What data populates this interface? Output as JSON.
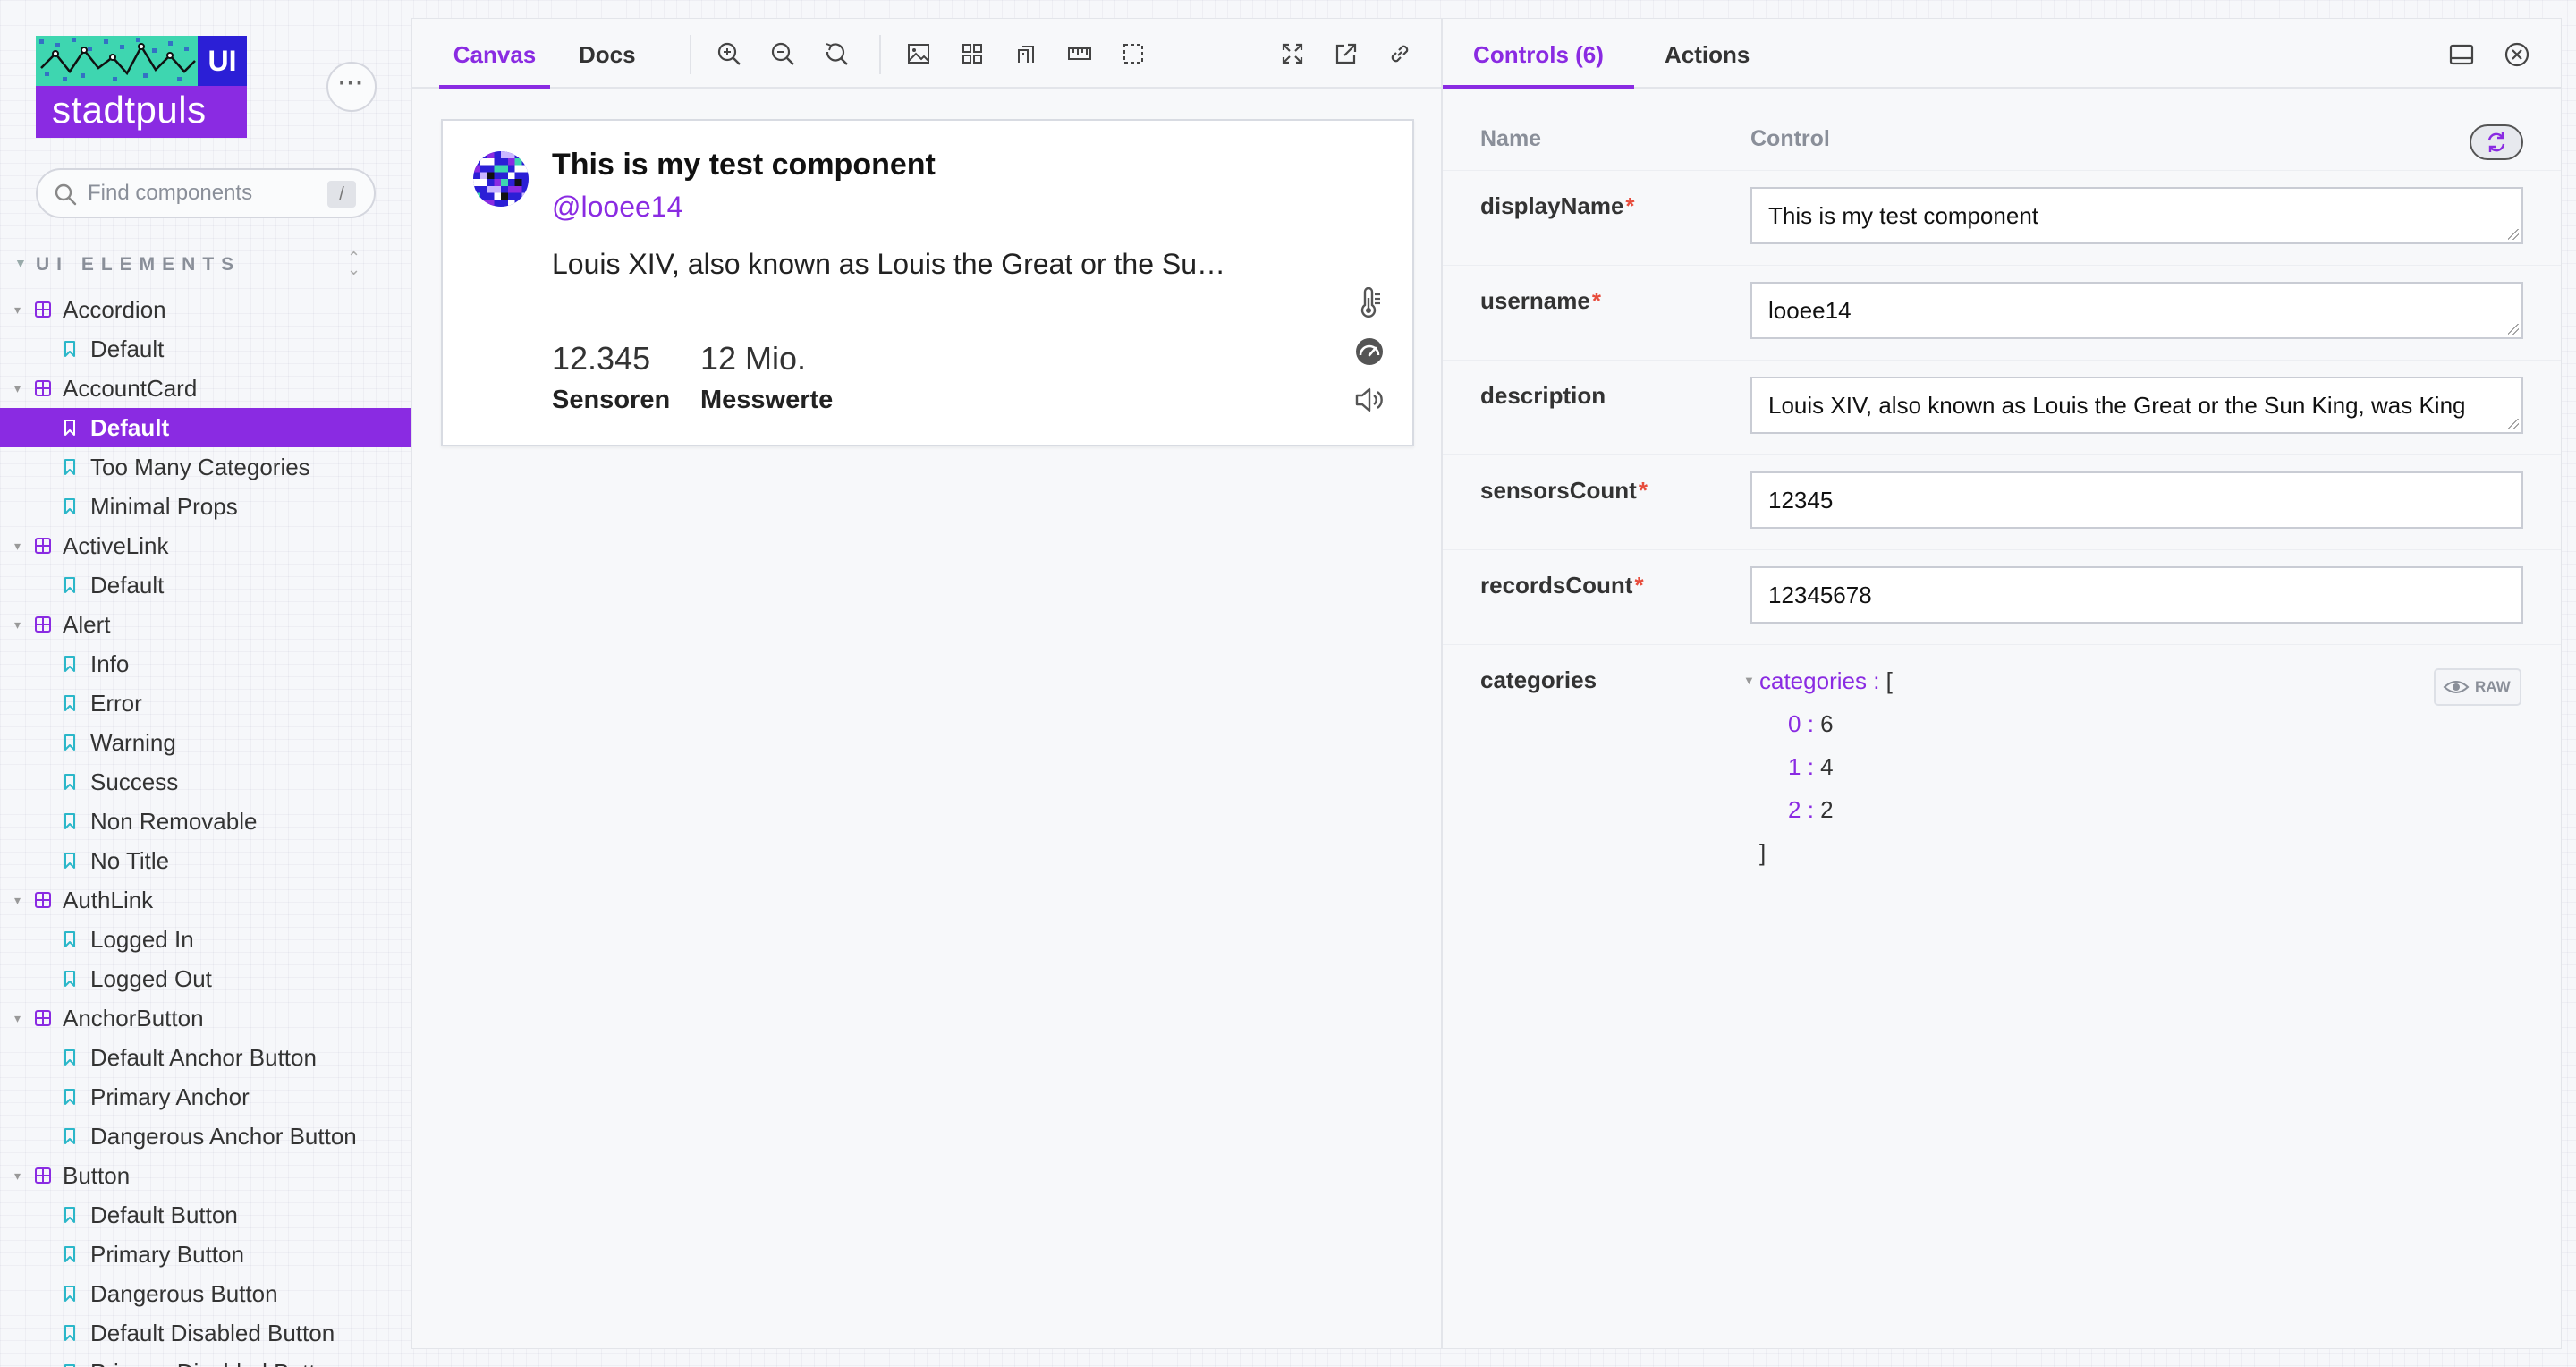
{
  "brand": {
    "logo_badge": "UI",
    "logo_name": "stadtpuls"
  },
  "sidebar": {
    "search_placeholder": "Find components",
    "search_shortcut": "/",
    "section_label": "UI ELEMENTS",
    "items": [
      {
        "type": "component",
        "label": "Accordion"
      },
      {
        "type": "story",
        "label": "Default"
      },
      {
        "type": "component",
        "label": "AccountCard"
      },
      {
        "type": "story",
        "label": "Default",
        "selected": true
      },
      {
        "type": "story",
        "label": "Too Many Categories"
      },
      {
        "type": "story",
        "label": "Minimal Props"
      },
      {
        "type": "component",
        "label": "ActiveLink"
      },
      {
        "type": "story",
        "label": "Default"
      },
      {
        "type": "component",
        "label": "Alert"
      },
      {
        "type": "story",
        "label": "Info"
      },
      {
        "type": "story",
        "label": "Error"
      },
      {
        "type": "story",
        "label": "Warning"
      },
      {
        "type": "story",
        "label": "Success"
      },
      {
        "type": "story",
        "label": "Non Removable"
      },
      {
        "type": "story",
        "label": "No Title"
      },
      {
        "type": "component",
        "label": "AuthLink"
      },
      {
        "type": "story",
        "label": "Logged In"
      },
      {
        "type": "story",
        "label": "Logged Out"
      },
      {
        "type": "component",
        "label": "AnchorButton"
      },
      {
        "type": "story",
        "label": "Default Anchor Button"
      },
      {
        "type": "story",
        "label": "Primary Anchor"
      },
      {
        "type": "story",
        "label": "Dangerous Anchor Button"
      },
      {
        "type": "component",
        "label": "Button"
      },
      {
        "type": "story",
        "label": "Default Button"
      },
      {
        "type": "story",
        "label": "Primary Button"
      },
      {
        "type": "story",
        "label": "Dangerous Button"
      },
      {
        "type": "story",
        "label": "Default Disabled Button"
      },
      {
        "type": "story",
        "label": "Primary Disabled Button"
      }
    ]
  },
  "canvas": {
    "tabs": [
      "Canvas",
      "Docs"
    ],
    "active_tab": "Canvas",
    "toolbar_icons": [
      "zoom-in-icon",
      "zoom-out-icon",
      "zoom-reset-icon",
      "image-icon",
      "grid-icon",
      "background-icon",
      "ruler-icon",
      "outline-icon",
      "fullscreen-icon",
      "open-new-tab-icon",
      "link-icon"
    ]
  },
  "preview": {
    "display_name": "This is my test component",
    "username": "@looee14",
    "description": "Louis XIV, also known as Louis the Great or the Su…",
    "stats": [
      {
        "value": "12.345",
        "label": "Sensoren"
      },
      {
        "value": "12 Mio.",
        "label": "Messwerte"
      }
    ],
    "category_icons": [
      "thermometer-icon",
      "gauge-icon",
      "speaker-icon"
    ]
  },
  "controls": {
    "tabs": [
      "Controls (6)",
      "Actions"
    ],
    "active_tab": "Controls (6)",
    "header_name": "Name",
    "header_control": "Control",
    "rows": {
      "displayName": {
        "name": "displayName",
        "required": "*",
        "value": "This is my test component"
      },
      "username": {
        "name": "username",
        "required": "*",
        "value": "looee14"
      },
      "description": {
        "name": "description",
        "required": "",
        "value": "Louis XIV, also known as Louis the Great or the Sun King, was King"
      },
      "sensorsCount": {
        "name": "sensorsCount",
        "required": "*",
        "value": "12345"
      },
      "recordsCount": {
        "name": "recordsCount",
        "required": "*",
        "value": "12345678"
      },
      "categories": {
        "name": "categories",
        "json_key": "categories",
        "open_bracket": "[",
        "close_bracket": "]",
        "entries": [
          {
            "index": "0",
            "value": "6"
          },
          {
            "index": "1",
            "value": "4"
          },
          {
            "index": "2",
            "value": "2"
          }
        ],
        "raw_label": "RAW"
      }
    }
  },
  "colors": {
    "accent": "#8a2be2",
    "logo_green": "#3ed6b0",
    "logo_blue": "#2b1fd6",
    "required": "#e74c3c"
  }
}
